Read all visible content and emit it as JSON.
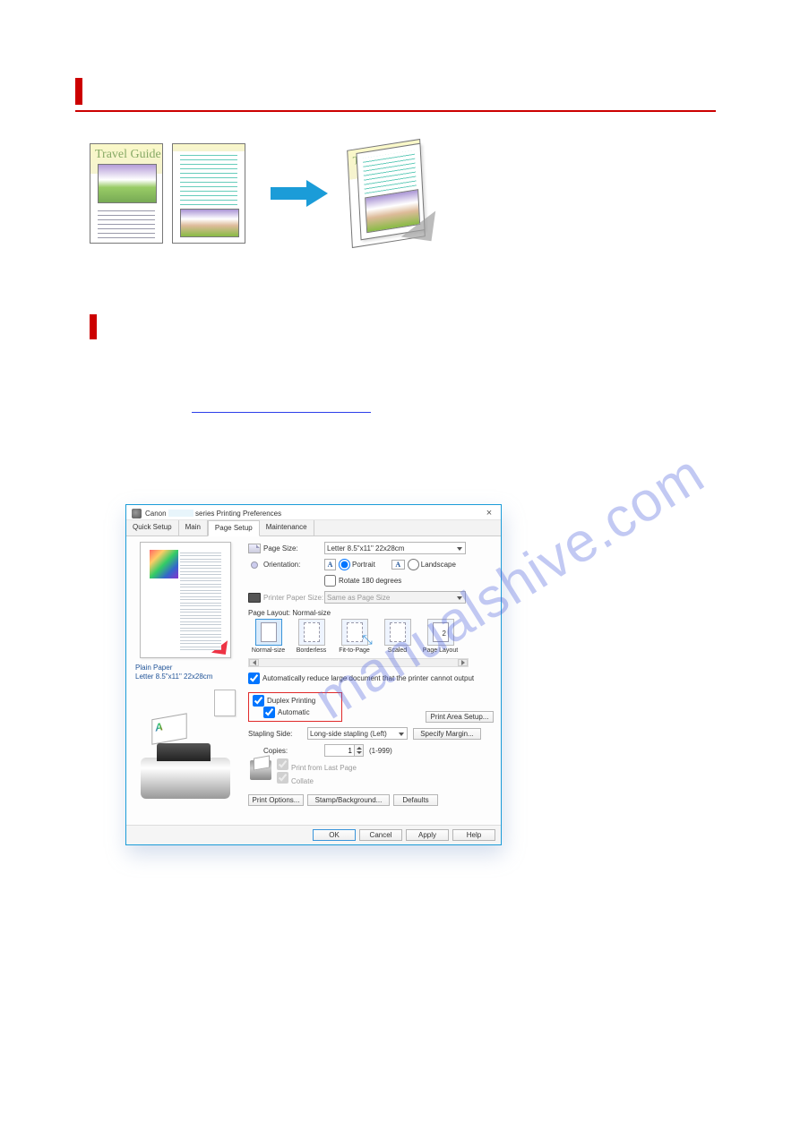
{
  "illustration": {
    "page1_title": "Travel Guide",
    "folded_title": "Travel Guide"
  },
  "dialog": {
    "title_prefix": "Canon",
    "title_suffix": "series Printing Preferences",
    "close": "×",
    "tabs": {
      "quick": "Quick Setup",
      "main": "Main",
      "page": "Page Setup",
      "maint": "Maintenance"
    },
    "left": {
      "paper_type": "Plain Paper",
      "paper_size": "Letter 8.5\"x11\" 22x28cm"
    },
    "right": {
      "page_size_label": "Page Size:",
      "page_size_value": "Letter 8.5\"x11\" 22x28cm",
      "orientation_label": "Orientation:",
      "portrait": "Portrait",
      "landscape": "Landscape",
      "rotate": "Rotate 180 degrees",
      "printer_paper_label": "Printer Paper Size:",
      "printer_paper_value": "Same as Page Size",
      "page_layout_label": "Page Layout: Normal-size",
      "layouts": {
        "normal": "Normal-size",
        "borderless": "Borderless",
        "fit": "Fit-to-Page",
        "scaled": "Scaled",
        "pagelayout": "Page Layout"
      },
      "auto_reduce": "Automatically reduce large document that the printer cannot output",
      "duplex": "Duplex Printing",
      "automatic": "Automatic",
      "print_area_btn": "Print Area Setup...",
      "stapling_label": "Stapling Side:",
      "stapling_value": "Long-side stapling (Left)",
      "margin_btn": "Specify Margin...",
      "copies_label": "Copies:",
      "copies_value": "1",
      "copies_range": "(1-999)",
      "print_last": "Print from Last Page",
      "collate": "Collate",
      "print_opts": "Print Options...",
      "stamp_bg": "Stamp/Background...",
      "defaults": "Defaults"
    },
    "footer": {
      "ok": "OK",
      "cancel": "Cancel",
      "apply": "Apply",
      "help": "Help"
    }
  },
  "watermark": "manualshive.com"
}
